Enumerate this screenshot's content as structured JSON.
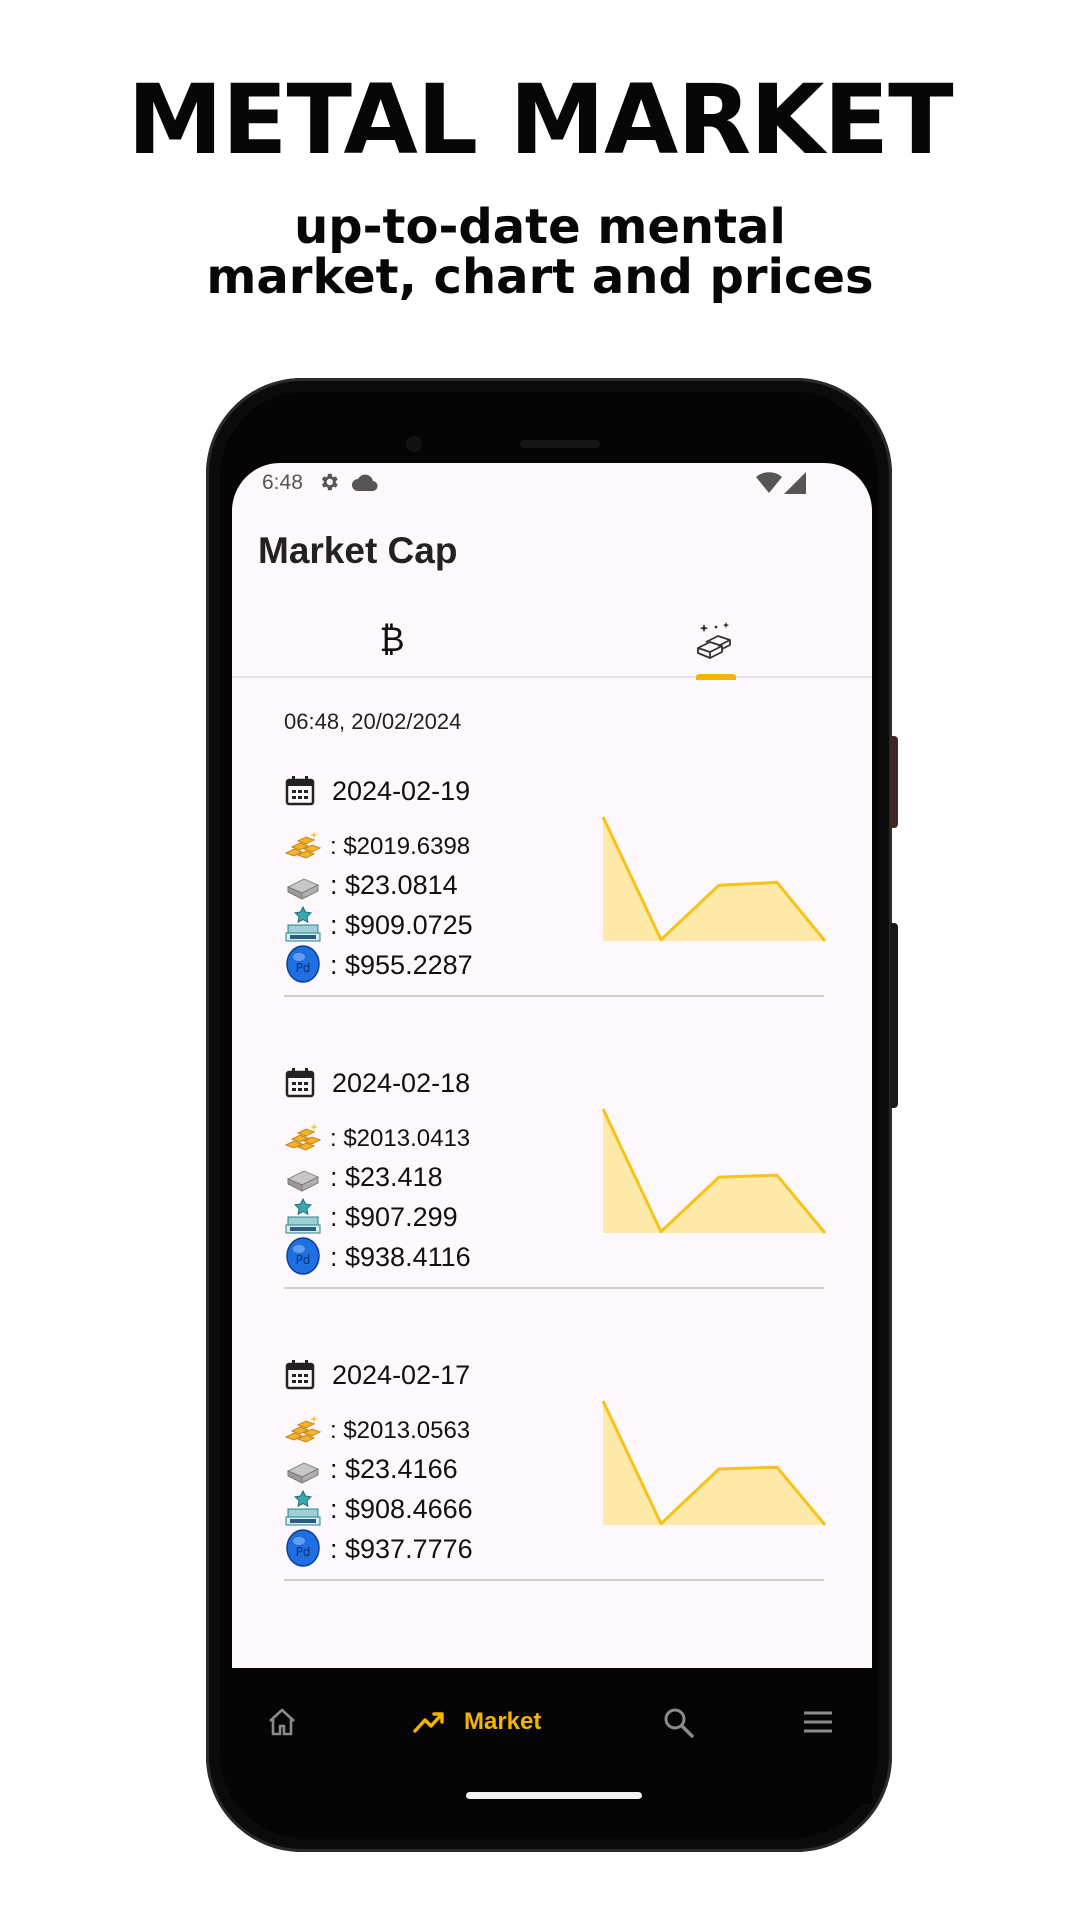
{
  "promo": {
    "title": "METAL MARKET",
    "subtitle_line1": "up-to-date mental",
    "subtitle_line2": "market, chart and prices"
  },
  "status_bar": {
    "time": "6:48",
    "icons": [
      "gear-icon",
      "cloud-icon",
      "wifi-icon",
      "cell-signal-icon"
    ]
  },
  "app_bar": {
    "title": "Market Cap"
  },
  "tabs": [
    {
      "icon": "bitcoin-icon",
      "glyph": "₿",
      "selected": false
    },
    {
      "icon": "metal-bars-icon",
      "selected": true
    }
  ],
  "timestamp": "06:48, 20/02/2024",
  "colors": {
    "accent": "#f6b400",
    "chart_fill": "#fde9a8",
    "chart_line": "#f7c21a",
    "screen_bg": "#fdf8fc"
  },
  "entries": [
    {
      "date": "2024-02-19",
      "gold": ": $2019.6398",
      "silver": ": $23.0814",
      "platinum": ": $909.0725",
      "palladium": ": $955.2287",
      "sparkline": [
        955.2287,
        23.0814,
        909.0725,
        2019.6398
      ]
    },
    {
      "date": "2024-02-18",
      "gold": ": $2013.0413",
      "silver": ": $23.418",
      "platinum": ": $907.299",
      "palladium": ": $938.4116",
      "sparkline": [
        938.4116,
        23.418,
        907.299,
        2013.0413
      ]
    },
    {
      "date": "2024-02-17",
      "gold": ": $2013.0563",
      "silver": ": $23.4166",
      "platinum": ": $908.4666",
      "palladium": ": $937.7776",
      "sparkline": [
        937.7776,
        23.4166,
        908.4666,
        2013.0563
      ]
    }
  ],
  "bottom_nav": {
    "items": [
      {
        "icon": "home-icon",
        "label": ""
      },
      {
        "icon": "trending-up-icon",
        "label": "Market",
        "selected": true
      },
      {
        "icon": "search-icon",
        "label": ""
      },
      {
        "icon": "menu-icon",
        "label": ""
      }
    ]
  }
}
